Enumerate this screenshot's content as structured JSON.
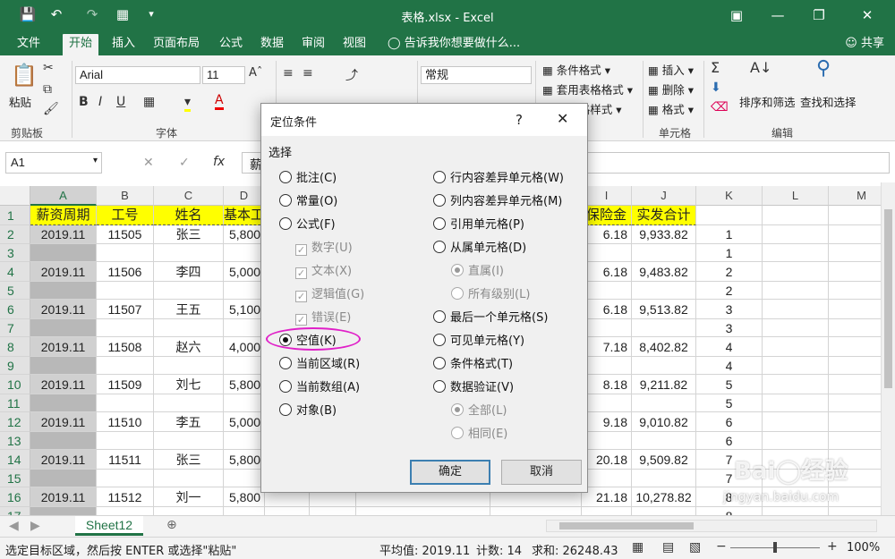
{
  "window": {
    "title": "表格.xlsx - Excel"
  },
  "ribbon_tabs": [
    "文件",
    "开始",
    "插入",
    "页面布局",
    "公式",
    "数据",
    "审阅",
    "视图"
  ],
  "tell_me": "告诉我你想要做什么...",
  "share": "共享",
  "ribbon": {
    "paste": "粘贴",
    "clipboard": "剪贴板",
    "font_name": "Arial",
    "font_size": "11",
    "font_group": "字体",
    "number_format": "常规",
    "conditional_format": "条件格式",
    "table_format": "套用表格格式",
    "cell_styles": "单元格样式",
    "insert": "插入",
    "delete": "删除",
    "format": "格式",
    "cells_group": "单元格",
    "sort_filter": "排序和筛选",
    "find_select": "查找和选择",
    "edit_group": "编辑"
  },
  "formula_bar": {
    "name_box": "A1",
    "content": "薪"
  },
  "columns": [
    "A",
    "B",
    "C",
    "D",
    "E",
    "F",
    "G",
    "H",
    "I",
    "J",
    "K",
    "L",
    "M"
  ],
  "rows": [
    "1",
    "2",
    "3",
    "4",
    "5",
    "6",
    "7",
    "8",
    "9",
    "10",
    "11",
    "12",
    "13",
    "14",
    "15",
    "16",
    "17"
  ],
  "headers": [
    "薪资周期",
    "工号",
    "姓名",
    "基本工",
    "保险金",
    "实发合计"
  ],
  "data_rows": [
    {
      "a": "2019.11",
      "b": "11505",
      "c": "张三",
      "d": "5,800",
      "i": "6.18",
      "j": "9,933.82",
      "k": "1"
    },
    {
      "a": "",
      "b": "",
      "c": "",
      "d": "",
      "i": "",
      "j": "",
      "k": "1"
    },
    {
      "a": "2019.11",
      "b": "11506",
      "c": "李四",
      "d": "5,000",
      "i": "6.18",
      "j": "9,483.82",
      "k": "2"
    },
    {
      "a": "",
      "b": "",
      "c": "",
      "d": "",
      "i": "",
      "j": "",
      "k": "2"
    },
    {
      "a": "2019.11",
      "b": "11507",
      "c": "王五",
      "d": "5,100",
      "i": "6.18",
      "j": "9,513.82",
      "k": "3"
    },
    {
      "a": "",
      "b": "",
      "c": "",
      "d": "",
      "i": "",
      "j": "",
      "k": "3"
    },
    {
      "a": "2019.11",
      "b": "11508",
      "c": "赵六",
      "d": "4,000",
      "i": "7.18",
      "j": "8,402.82",
      "k": "4"
    },
    {
      "a": "",
      "b": "",
      "c": "",
      "d": "",
      "i": "",
      "j": "",
      "k": "4"
    },
    {
      "a": "2019.11",
      "b": "11509",
      "c": "刘七",
      "d": "5,800",
      "i": "8.18",
      "j": "9,211.82",
      "k": "5"
    },
    {
      "a": "",
      "b": "",
      "c": "",
      "d": "",
      "i": "",
      "j": "",
      "k": "5"
    },
    {
      "a": "2019.11",
      "b": "11510",
      "c": "李五",
      "d": "5,000",
      "i": "9.18",
      "j": "9,010.82",
      "k": "6"
    },
    {
      "a": "",
      "b": "",
      "c": "",
      "d": "",
      "i": "",
      "j": "",
      "k": "6"
    },
    {
      "a": "2019.11",
      "b": "11511",
      "c": "张三",
      "d": "5,800",
      "i": "20.18",
      "j": "9,509.82",
      "k": "7"
    },
    {
      "a": "",
      "b": "",
      "c": "",
      "d": "",
      "i": "",
      "j": "",
      "k": "7"
    },
    {
      "a": "2019.11",
      "b": "11512",
      "c": "刘一",
      "d": "5,800",
      "i": "21.18",
      "j": "10,278.82",
      "k": "8"
    },
    {
      "a": "",
      "b": "",
      "c": "",
      "d": "",
      "i": "",
      "j": "",
      "k": "8"
    }
  ],
  "dialog": {
    "title": "定位条件",
    "help": "?",
    "section": "选择",
    "left_options": [
      "批注(C)",
      "常量(O)",
      "公式(F)",
      "数字(U)",
      "文本(X)",
      "逻辑值(G)",
      "错误(E)",
      "空值(K)",
      "当前区域(R)",
      "当前数组(A)",
      "对象(B)"
    ],
    "right_options": [
      "行内容差异单元格(W)",
      "列内容差异单元格(M)",
      "引用单元格(P)",
      "从属单元格(D)",
      "直属(I)",
      "所有级别(L)",
      "最后一个单元格(S)",
      "可见单元格(Y)",
      "条件格式(T)",
      "数据验证(V)",
      "全部(L)",
      "相同(E)"
    ],
    "ok": "确定",
    "cancel": "取消"
  },
  "sheet_tab": "Sheet12",
  "status": {
    "message": "选定目标区域，然后按 ENTER 或选择\"粘贴\"",
    "average": "平均值: 2019.11",
    "count": "计数: 14",
    "sum": "求和: 26248.43",
    "zoom": "100%"
  },
  "watermark": "jingyan.baidu.com",
  "colors": {
    "excel_green": "#217346",
    "header_yellow": "#ffff00",
    "highlight_circle": "#e020c8"
  }
}
